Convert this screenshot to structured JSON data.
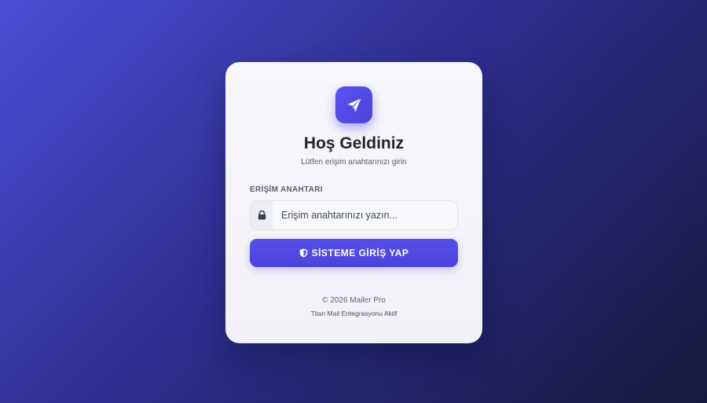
{
  "app": {
    "name": "Mailer Pro"
  },
  "login": {
    "logo_icon": "paper-plane-icon",
    "title": "Hoş Geldiniz",
    "subtitle": "Lütfen erişim anahtarınızı girin",
    "field_label": "ERİŞİM ANAHTARI",
    "field_icon": "lock-icon",
    "placeholder": "Erişim anahtarınızı yazın...",
    "value": "",
    "submit_icon": "shield-icon",
    "submit_label": "SİSTEME GİRİŞ YAP"
  },
  "footer": {
    "copyright": "© 2026 Mailer Pro",
    "integration": "Titan Mail Entegrasyonu Aktif"
  },
  "colors": {
    "accent": "#4f46e5",
    "card_bg": "#f4f4f9",
    "title": "#23232e",
    "background_start": "#4a4fd6",
    "background_end": "#151a3d"
  }
}
